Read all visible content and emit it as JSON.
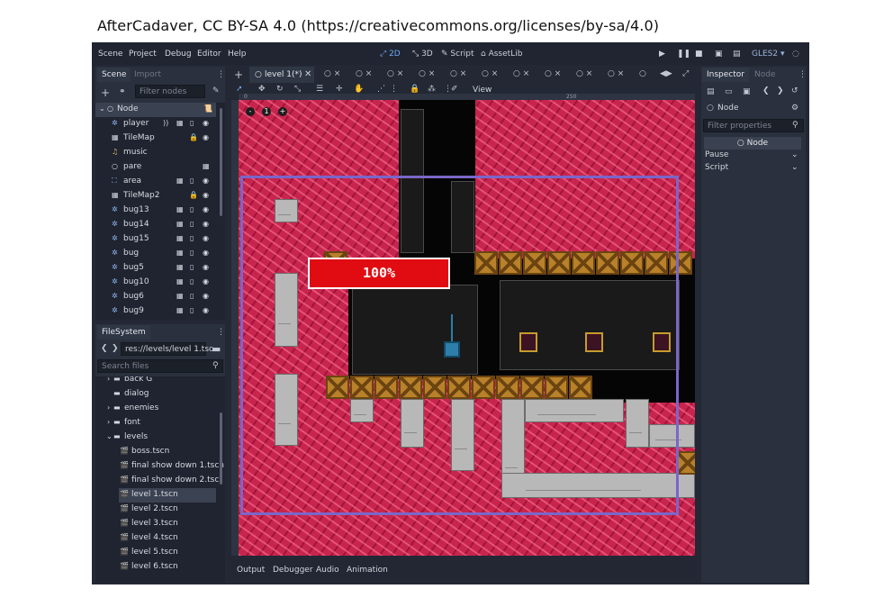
{
  "caption": "AfterCadaver, CC BY-SA 4.0 (https://creativecommons.org/licenses/by-sa/4.0)",
  "menu": [
    "Scene",
    "Project",
    "Debug",
    "Editor",
    "Help"
  ],
  "workspaces": [
    {
      "label": "2D",
      "icon": "2d-icon"
    },
    {
      "label": "3D",
      "icon": "3d-icon"
    },
    {
      "label": "Script",
      "icon": "script-icon"
    },
    {
      "label": "AssetLib",
      "icon": "assetlib-icon"
    }
  ],
  "renderer": "GLES2",
  "scene_dock": {
    "tabs": [
      "Scene",
      "Import"
    ],
    "filter_placeholder": "Filter nodes",
    "nodes": [
      {
        "label": "Node",
        "icon": "circle-icon",
        "indent": 0
      },
      {
        "label": "player",
        "icon": "kinematic-body-icon",
        "indent": 1
      },
      {
        "label": "TileMap",
        "icon": "tilemap-icon",
        "indent": 1
      },
      {
        "label": "music",
        "icon": "audio-icon",
        "indent": 1
      },
      {
        "label": "pare",
        "icon": "circle-icon",
        "indent": 1
      },
      {
        "label": "area",
        "icon": "area-icon",
        "indent": 1
      },
      {
        "label": "TileMap2",
        "icon": "tilemap-icon",
        "indent": 1
      },
      {
        "label": "bug13",
        "icon": "kinematic-body-icon",
        "indent": 1
      },
      {
        "label": "bug14",
        "icon": "kinematic-body-icon",
        "indent": 1
      },
      {
        "label": "bug15",
        "icon": "kinematic-body-icon",
        "indent": 1
      },
      {
        "label": "bug",
        "icon": "kinematic-body-icon",
        "indent": 1
      },
      {
        "label": "bug5",
        "icon": "kinematic-body-icon",
        "indent": 1
      },
      {
        "label": "bug10",
        "icon": "kinematic-body-icon",
        "indent": 1
      },
      {
        "label": "bug6",
        "icon": "kinematic-body-icon",
        "indent": 1
      },
      {
        "label": "bug9",
        "icon": "kinematic-body-icon",
        "indent": 1
      }
    ]
  },
  "filesystem_dock": {
    "tab": "FileSystem",
    "path": "res://levels/level 1.tsc",
    "search_placeholder": "Search files",
    "items": [
      {
        "label": "back G",
        "type": "folder",
        "indent": 0
      },
      {
        "label": "dialog",
        "type": "folder",
        "indent": 0
      },
      {
        "label": "enemies",
        "type": "folder",
        "indent": 0
      },
      {
        "label": "font",
        "type": "folder",
        "indent": 0
      },
      {
        "label": "levels",
        "type": "folder",
        "indent": 0
      },
      {
        "label": "boss.tscn",
        "type": "scene",
        "indent": 1
      },
      {
        "label": "final show down 1.tscn",
        "type": "scene",
        "indent": 1
      },
      {
        "label": "final show down 2.tsc",
        "type": "scene",
        "indent": 1
      },
      {
        "label": "level 1.tscn",
        "type": "scene",
        "indent": 1,
        "selected": true
      },
      {
        "label": "level 2.tscn",
        "type": "scene",
        "indent": 1
      },
      {
        "label": "level 3.tscn",
        "type": "scene",
        "indent": 1
      },
      {
        "label": "level 4.tscn",
        "type": "scene",
        "indent": 1
      },
      {
        "label": "level 5.tscn",
        "type": "scene",
        "indent": 1
      },
      {
        "label": "level 6.tscn",
        "type": "scene",
        "indent": 1
      }
    ]
  },
  "editor_tabs": [
    {
      "label": "level 1(*)",
      "active": true
    }
  ],
  "viewport": {
    "toolbar_view_label": "View",
    "hud_text": "100%",
    "ruler_marks": [
      "0",
      "250"
    ],
    "zoom_labels": [
      "-",
      "1",
      "+"
    ]
  },
  "bottom_tabs": [
    "Output",
    "Debugger",
    "Audio",
    "Animation"
  ],
  "inspector": {
    "tabs": [
      "Inspector",
      "Node"
    ],
    "object_name": "Node",
    "filter_placeholder": "Filter properties",
    "section_title": "Node",
    "properties": [
      "Pause",
      "Script"
    ]
  },
  "colors": {
    "editor_bg": "#232834",
    "panel_bg": "#2a303d",
    "accent": "#6fa8f2",
    "level_red": "#c7254e",
    "camera_rect": "#7b66c9",
    "hud_red": "#e00c12"
  }
}
